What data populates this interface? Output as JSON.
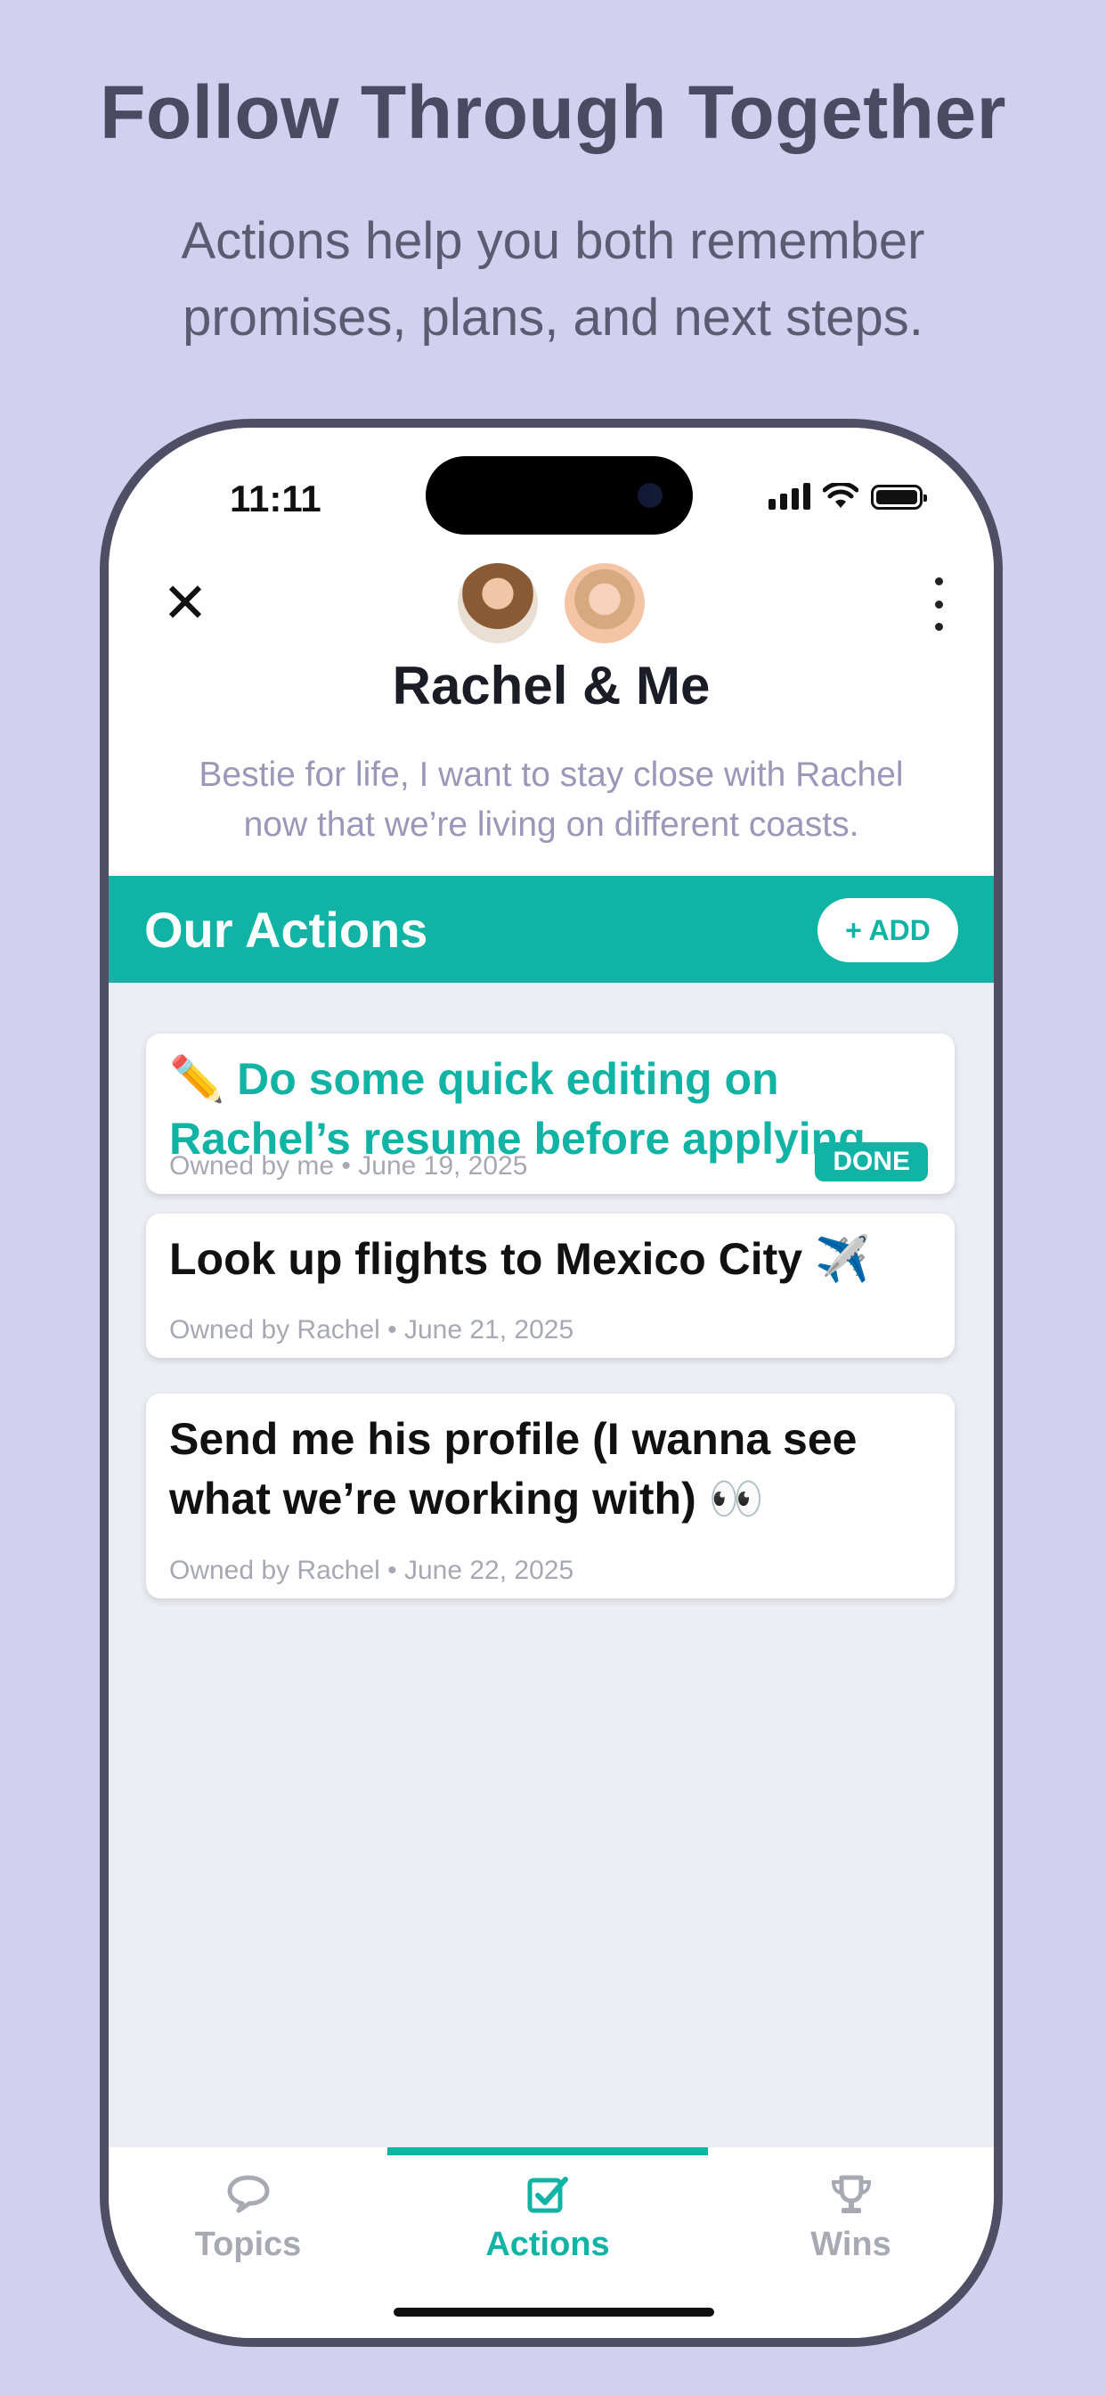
{
  "promo": {
    "headline": "Follow Through Together",
    "subline_line1": "Actions help you both remember",
    "subline_line2": "promises, plans, and next steps."
  },
  "status_bar": {
    "time": "11:11"
  },
  "header": {
    "title": "Rachel & Me",
    "description_line1": "Bestie for life, I want to stay close with Rachel",
    "description_line2": "now that we’re living on different coasts."
  },
  "actions_section": {
    "title": "Our Actions",
    "add_label": "+ ADD"
  },
  "actions": [
    {
      "text_line1": "✏️ Do some quick editing on",
      "text_line2": "Rachel’s resume before applying",
      "meta": "Owned by me • June 19, 2025",
      "status": "DONE"
    },
    {
      "text_line1": "Look up flights to Mexico City ✈️",
      "meta": "Owned by Rachel • June 21, 2025"
    },
    {
      "text_line1": "Send me his profile (I wanna see",
      "text_line2": "what we’re working with) 👀",
      "meta": "Owned by Rachel • June 22, 2025"
    }
  ],
  "tabs": [
    {
      "label": "Topics",
      "icon": "speech-bubble-icon",
      "active": false
    },
    {
      "label": "Actions",
      "icon": "checkbox-icon",
      "active": true
    },
    {
      "label": "Wins",
      "icon": "trophy-icon",
      "active": false
    }
  ],
  "colors": {
    "accent": "#10b3a4",
    "background": "#d1d0ef",
    "inactive_tab": "#a9a9b3"
  }
}
